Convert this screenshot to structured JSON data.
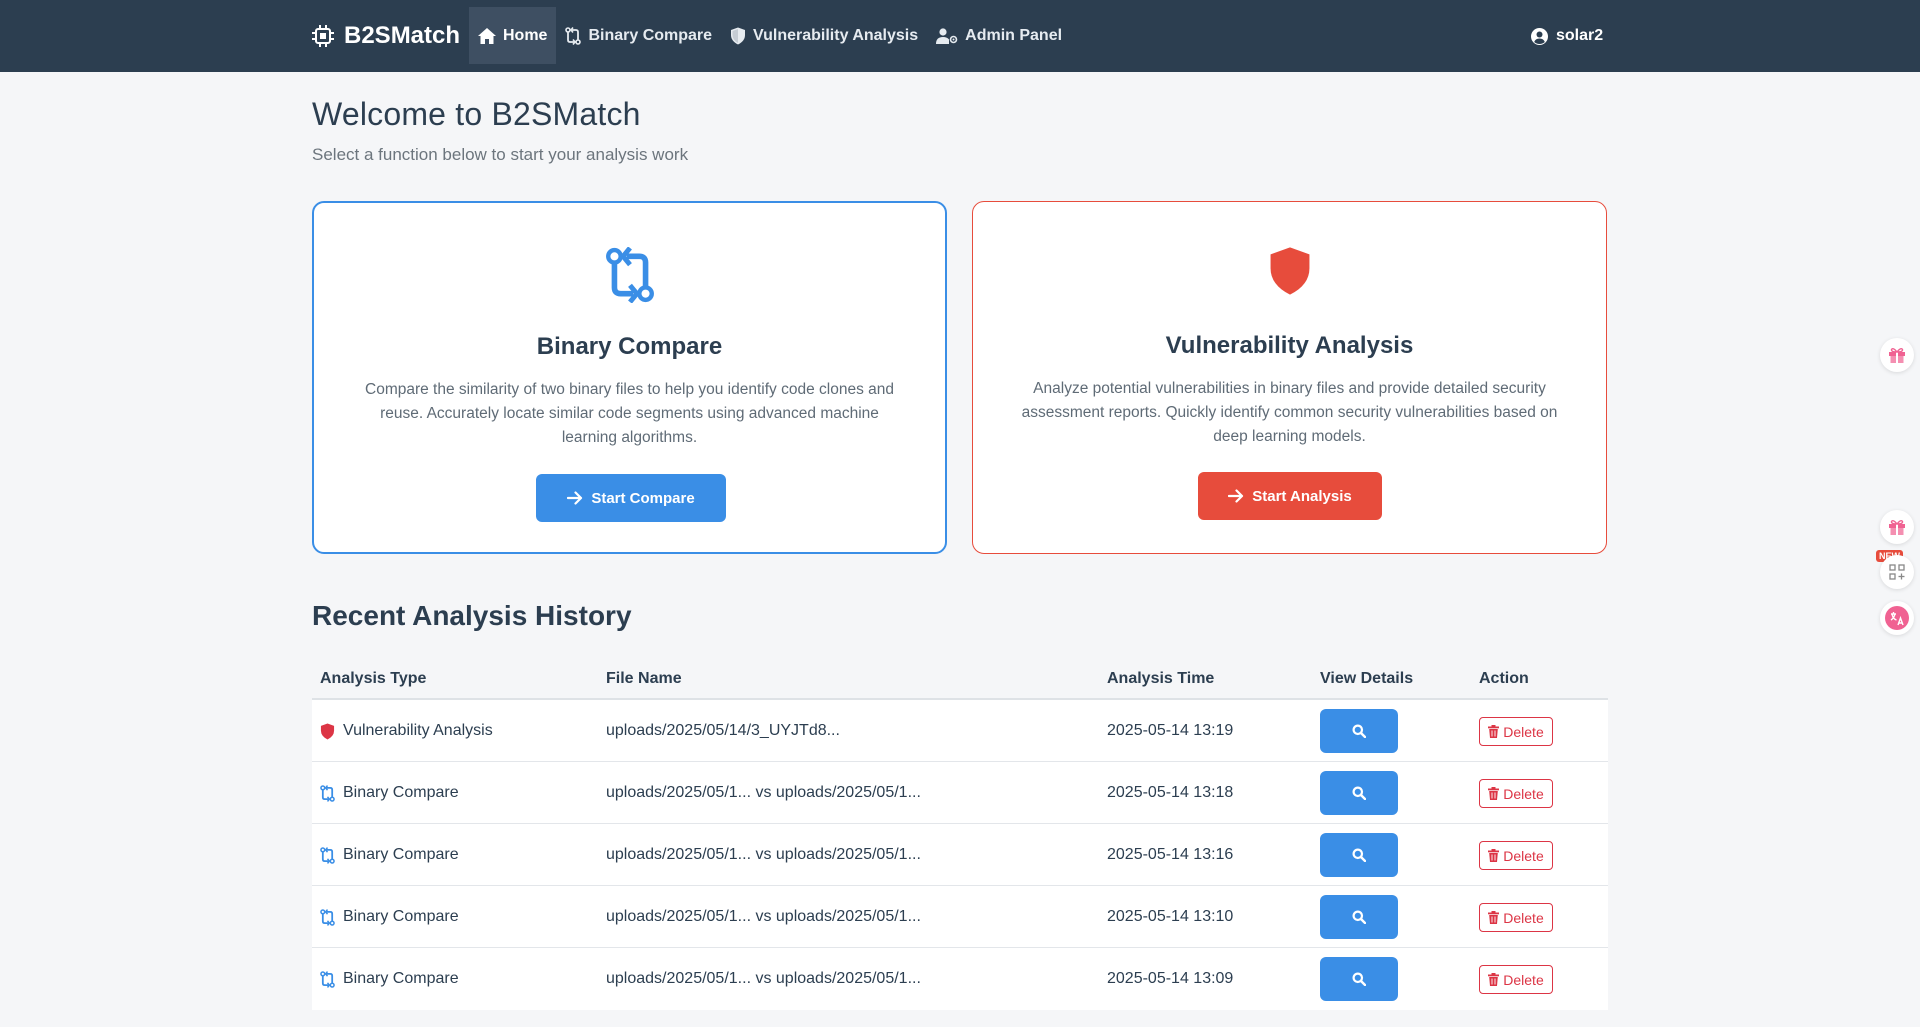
{
  "brand": {
    "name": "B2SMatch"
  },
  "nav": {
    "items": [
      {
        "label": "Home",
        "icon": "home-icon",
        "active": true
      },
      {
        "label": "Binary Compare",
        "icon": "compare-icon",
        "active": false
      },
      {
        "label": "Vulnerability Analysis",
        "icon": "shield-icon",
        "active": false
      },
      {
        "label": "Admin Panel",
        "icon": "admin-user-icon",
        "active": false
      }
    ],
    "user": "solar2"
  },
  "header": {
    "title": "Welcome to B2SMatch",
    "subtitle": "Select a function below to start your analysis work"
  },
  "cards": [
    {
      "title": "Binary Compare",
      "description": "Compare the similarity of two binary files to help you identify code clones and reuse. Accurately locate similar code segments using advanced machine learning algorithms.",
      "button": "Start Compare",
      "color": "#3a8ee6"
    },
    {
      "title": "Vulnerability Analysis",
      "description": "Analyze potential vulnerabilities in binary files and provide detailed security assessment reports. Quickly identify common security vulnerabilities based on deep learning models.",
      "button": "Start Analysis",
      "color": "#e74c3c"
    }
  ],
  "history": {
    "title": "Recent Analysis History",
    "columns": [
      "Analysis Type",
      "File Name",
      "Analysis Time",
      "View Details",
      "Action"
    ],
    "delete_label": "Delete",
    "rows": [
      {
        "type": "Vulnerability Analysis",
        "icon": "shield-icon",
        "file": "uploads/2025/05/14/3_UYJTd8...",
        "time": "2025-05-14 13:19"
      },
      {
        "type": "Binary Compare",
        "icon": "compare-icon",
        "file": "uploads/2025/05/1... vs uploads/2025/05/1...",
        "time": "2025-05-14 13:18"
      },
      {
        "type": "Binary Compare",
        "icon": "compare-icon",
        "file": "uploads/2025/05/1... vs uploads/2025/05/1...",
        "time": "2025-05-14 13:16"
      },
      {
        "type": "Binary Compare",
        "icon": "compare-icon",
        "file": "uploads/2025/05/1... vs uploads/2025/05/1...",
        "time": "2025-05-14 13:10"
      },
      {
        "type": "Binary Compare",
        "icon": "compare-icon",
        "file": "uploads/2025/05/1... vs uploads/2025/05/1...",
        "time": "2025-05-14 13:09"
      }
    ]
  },
  "side_widgets": {
    "new_badge": "NEW"
  },
  "colors": {
    "navbar": "#2c3e50",
    "primary": "#3a8ee6",
    "danger": "#e74c3c"
  }
}
